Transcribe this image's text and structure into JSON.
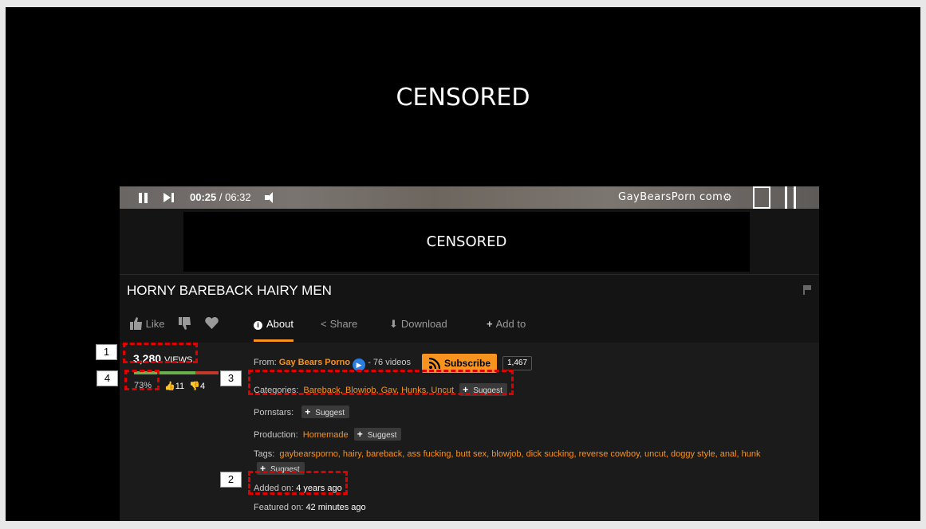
{
  "slide": {
    "censor_top": "CENSORED",
    "censor_video": "CENSORED"
  },
  "player": {
    "time_current": "00:25",
    "time_total": " / 06:32",
    "brand_watermark": "GayBearsPorn  com",
    "icons": [
      "pause-icon",
      "next-icon",
      "volume-icon",
      "gear-icon",
      "screen-mode-icon",
      "fullscreen-icon"
    ]
  },
  "video": {
    "title": "HORNY BAREBACK HAIRY MEN"
  },
  "actions": {
    "like": "Like",
    "about": "About",
    "share": "Share",
    "download": "Download",
    "add_to": "Add to"
  },
  "stats": {
    "views_count": "3,280",
    "views_label": "VIEWS",
    "rating_percent": "73%",
    "rating_fraction": 0.73,
    "thumbs_up": "11",
    "thumbs_down": "4"
  },
  "details": {
    "from_label": "From:",
    "channel": "Gay Bears Porno",
    "video_count": "- 76 videos",
    "subscribe": "Subscribe",
    "subscriber_count": "1,467",
    "categories_label": "Categories:",
    "categories": "Bareback, Blowjob, Gay, Hunks, Uncut",
    "suggest": "Suggest",
    "pornstars_label": "Pornstars:",
    "production_label": "Production:",
    "production": "Homemade",
    "tags_label": "Tags:",
    "tags": "gaybearsporno, hairy, bareback, ass fucking, butt sex, blowjob, dick sucking, reverse cowboy, uncut, doggy style, anal, hunk",
    "added_label": "Added on:",
    "added_value": "4 years ago",
    "featured_label": "Featured on:",
    "featured_value": "42 minutes ago"
  },
  "annotations": [
    "1",
    "2",
    "3",
    "4"
  ],
  "colors": {
    "accent": "#f7931e",
    "annotation": "#e00000",
    "rating_good": "#6ab04c",
    "rating_bad": "#c0392b"
  }
}
